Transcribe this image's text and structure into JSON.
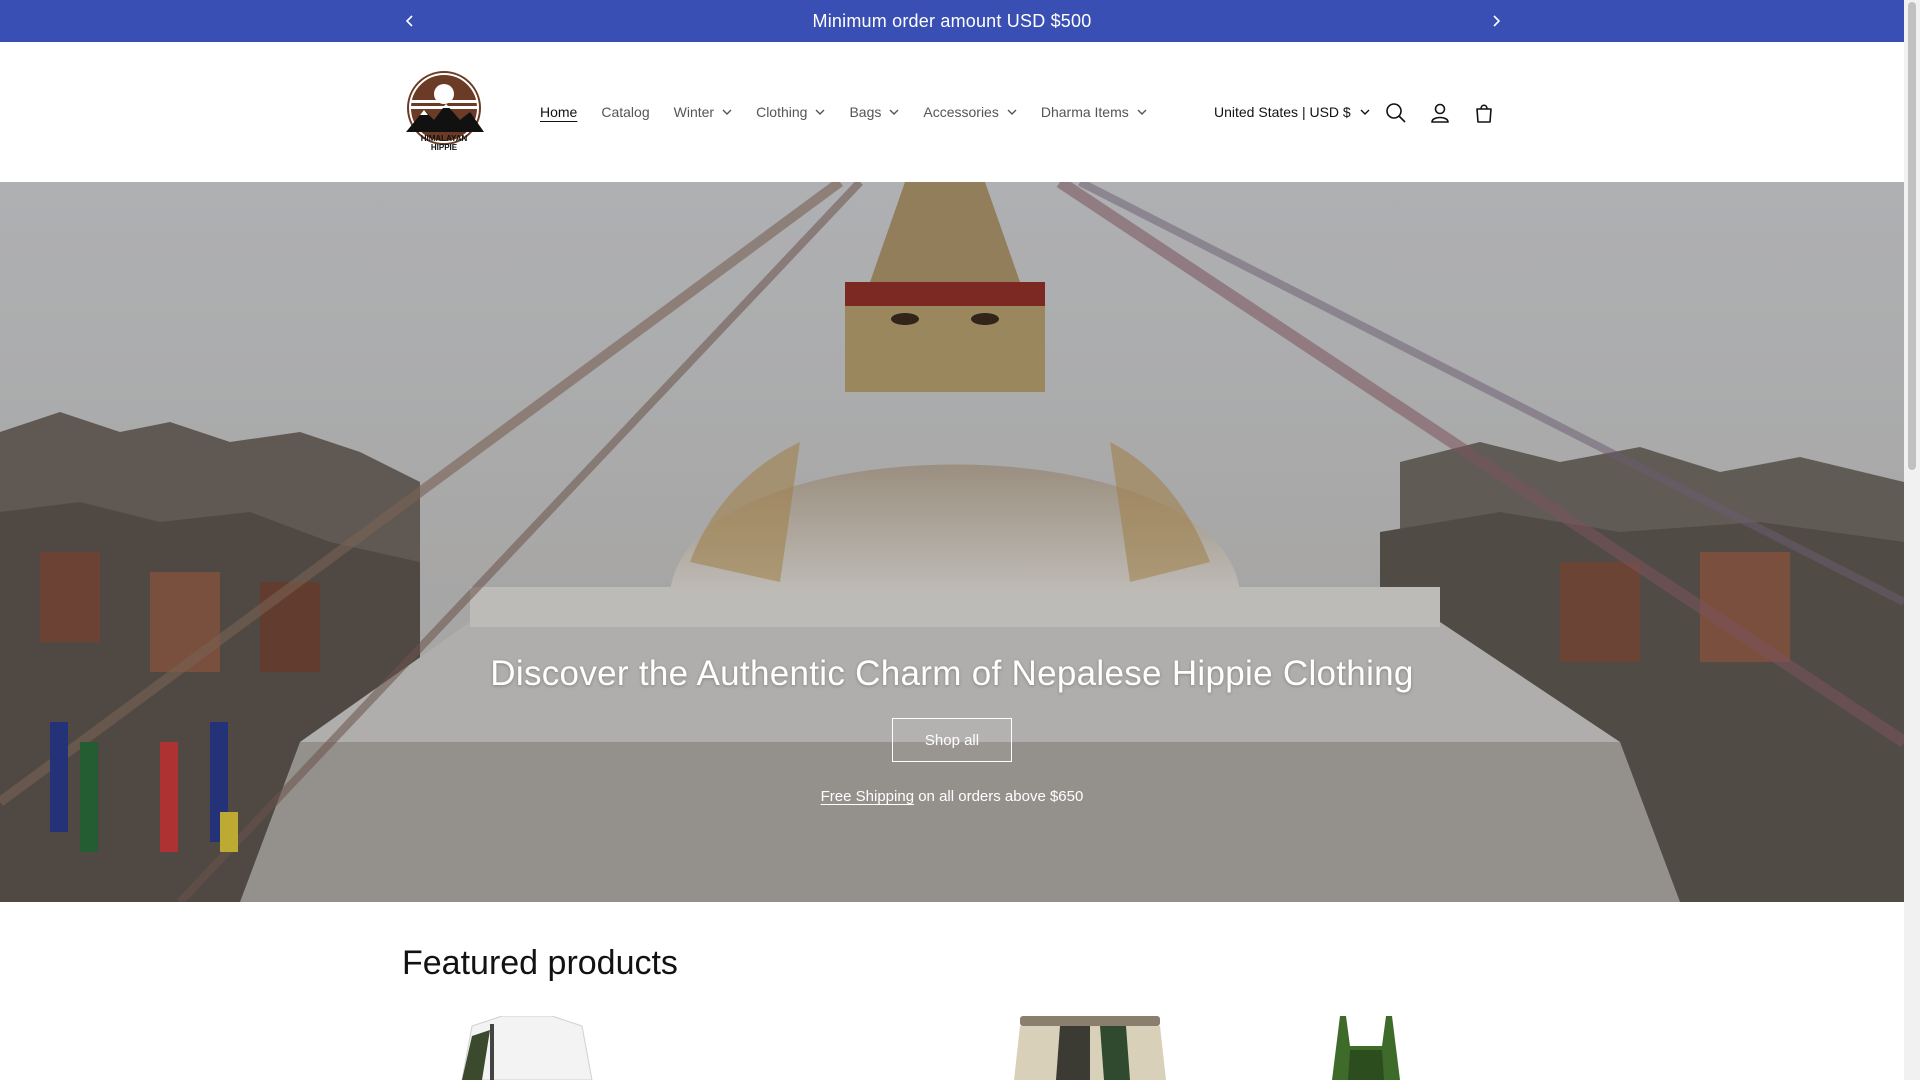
{
  "announcement": {
    "text": "Minimum order amount USD $500"
  },
  "brand": {
    "name_line1": "HIMALAYAN",
    "name_line2": "HIPPIE"
  },
  "nav": {
    "items": [
      {
        "label": "Home",
        "active": true,
        "has_dropdown": false
      },
      {
        "label": "Catalog",
        "active": false,
        "has_dropdown": false
      },
      {
        "label": "Winter",
        "active": false,
        "has_dropdown": true
      },
      {
        "label": "Clothing",
        "active": false,
        "has_dropdown": true
      },
      {
        "label": "Bags",
        "active": false,
        "has_dropdown": true
      },
      {
        "label": "Accessories",
        "active": false,
        "has_dropdown": true
      },
      {
        "label": "Dharma Items",
        "active": false,
        "has_dropdown": true
      }
    ]
  },
  "header": {
    "country_selector": "United States | USD $",
    "icons": [
      "search-icon",
      "account-icon",
      "cart-icon"
    ]
  },
  "hero": {
    "title": "Discover the Authentic Charm of Nepalese Hippie Clothing",
    "button_label": "Shop all",
    "subtext_link": "Free Shipping",
    "subtext_rest": " on all orders above $650"
  },
  "featured": {
    "title": "Featured products"
  },
  "colors": {
    "announcement_bg": "#3a4fb3",
    "text": "#121212",
    "logo_brown": "#6b3b26"
  }
}
